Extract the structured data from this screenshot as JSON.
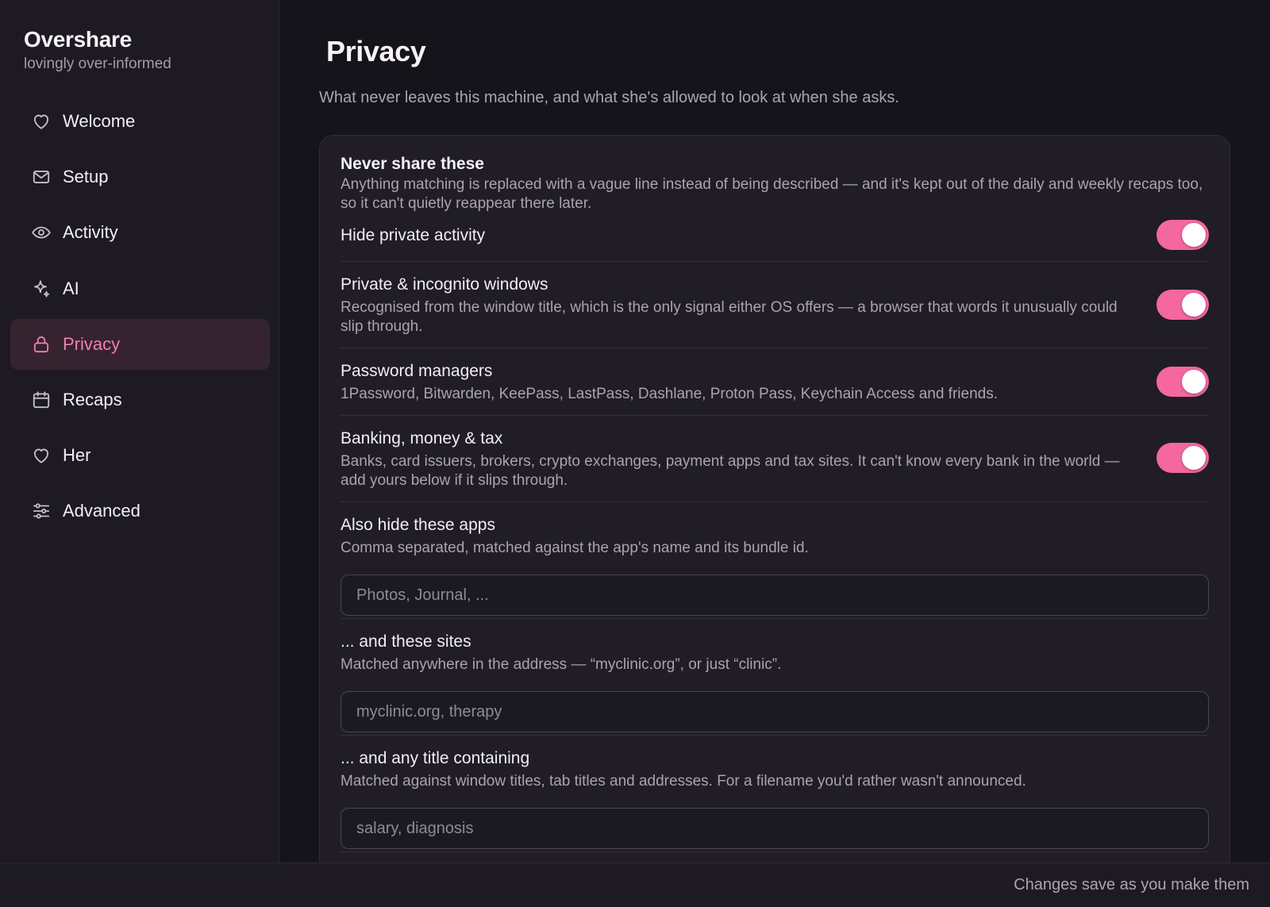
{
  "app": {
    "name": "Overshare",
    "tagline": "lovingly over-informed"
  },
  "sidebar": {
    "items": [
      {
        "label": "Welcome",
        "icon": "heart-icon",
        "active": false
      },
      {
        "label": "Setup",
        "icon": "envelope-icon",
        "active": false
      },
      {
        "label": "Activity",
        "icon": "eye-icon",
        "active": false
      },
      {
        "label": "AI",
        "icon": "sparkle-icon",
        "active": false
      },
      {
        "label": "Privacy",
        "icon": "lock-icon",
        "active": true
      },
      {
        "label": "Recaps",
        "icon": "calendar-icon",
        "active": false
      },
      {
        "label": "Her",
        "icon": "heart-icon",
        "active": false
      },
      {
        "label": "Advanced",
        "icon": "sliders-icon",
        "active": false
      }
    ]
  },
  "page": {
    "title": "Privacy",
    "subtitle": "What never leaves this machine, and what she's allowed to look at when she asks."
  },
  "section": {
    "title": "Never share these",
    "description": "Anything matching is replaced with a vague line instead of being described — and it's kept out of the daily and weekly recaps too, so it can't quietly reappear there later."
  },
  "toggles": [
    {
      "title": "Hide private activity",
      "description": "",
      "on": true
    },
    {
      "title": "Private & incognito windows",
      "description": "Recognised from the window title, which is the only signal either OS offers — a browser that words it unusually could slip through.",
      "on": true
    },
    {
      "title": "Password managers",
      "description": "1Password, Bitwarden, KeePass, LastPass, Dashlane, Proton Pass, Keychain Access and friends.",
      "on": true
    },
    {
      "title": "Banking, money & tax",
      "description": "Banks, card issuers, brokers, crypto exchanges, payment apps and tax sites. It can't know every bank in the world — add yours below if it slips through.",
      "on": true
    }
  ],
  "fields": [
    {
      "title": "Also hide these apps",
      "description": "Comma separated, matched against the app's name and its bundle id.",
      "placeholder": "Photos, Journal, ...",
      "value": ""
    },
    {
      "title": "... and these sites",
      "description": "Matched anywhere in the address — “myclinic.org”, or just “clinic”.",
      "placeholder": "myclinic.org, therapy",
      "value": ""
    },
    {
      "title": "... and any title containing",
      "description": "Matched against window titles, tab titles and addresses. For a filename you'd rather wasn't announced.",
      "placeholder": "salary, diagnosis",
      "value": ""
    }
  ],
  "footer": {
    "status": "Changes save as you make them"
  },
  "colors": {
    "accent": "#f4679f",
    "active_nav_bg": "#35242f",
    "active_nav_text": "#f47eb0",
    "background": "#16141b",
    "sidebar_bg": "#1d1a23",
    "card_bg": "#201d26"
  }
}
